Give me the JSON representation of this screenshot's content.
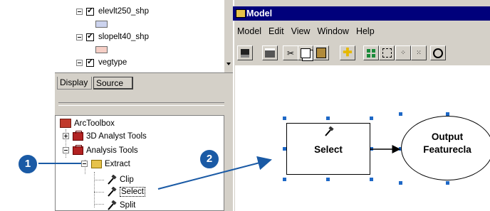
{
  "layers": [
    {
      "name": "elevlt250_shp",
      "swatch_color": "#ccd3ee"
    },
    {
      "name": "slopelt40_shp",
      "swatch_color": "#f6cfc6"
    },
    {
      "name": "vegtype"
    }
  ],
  "tabs": {
    "display": "Display",
    "source": "Source"
  },
  "toolbox": {
    "root": "ArcToolbox",
    "items": [
      "3D Analyst Tools",
      "Analysis Tools",
      "Extract",
      "Clip",
      "Select",
      "Split"
    ]
  },
  "model": {
    "title": "Model",
    "menu": [
      "Model",
      "Edit",
      "View",
      "Window",
      "Help"
    ],
    "toolbar_icons": [
      "save-icon",
      "print-icon",
      "cut-icon",
      "copy-icon",
      "paste-icon",
      "add-data-icon",
      "select-all-icon",
      "full-extent-icon",
      "zoom-in-fixed-icon",
      "zoom-out-fixed-icon",
      "zoom-icon"
    ],
    "process_label": "Select",
    "output_label_line1": "Output",
    "output_label_line2": "Featurecla"
  },
  "callouts": [
    "1",
    "2"
  ],
  "colors": {
    "title_bg": "#00007b",
    "accent_blue": "#1a5aa5",
    "handle": "#1e68c6",
    "chrome": "#d4d0c8"
  }
}
